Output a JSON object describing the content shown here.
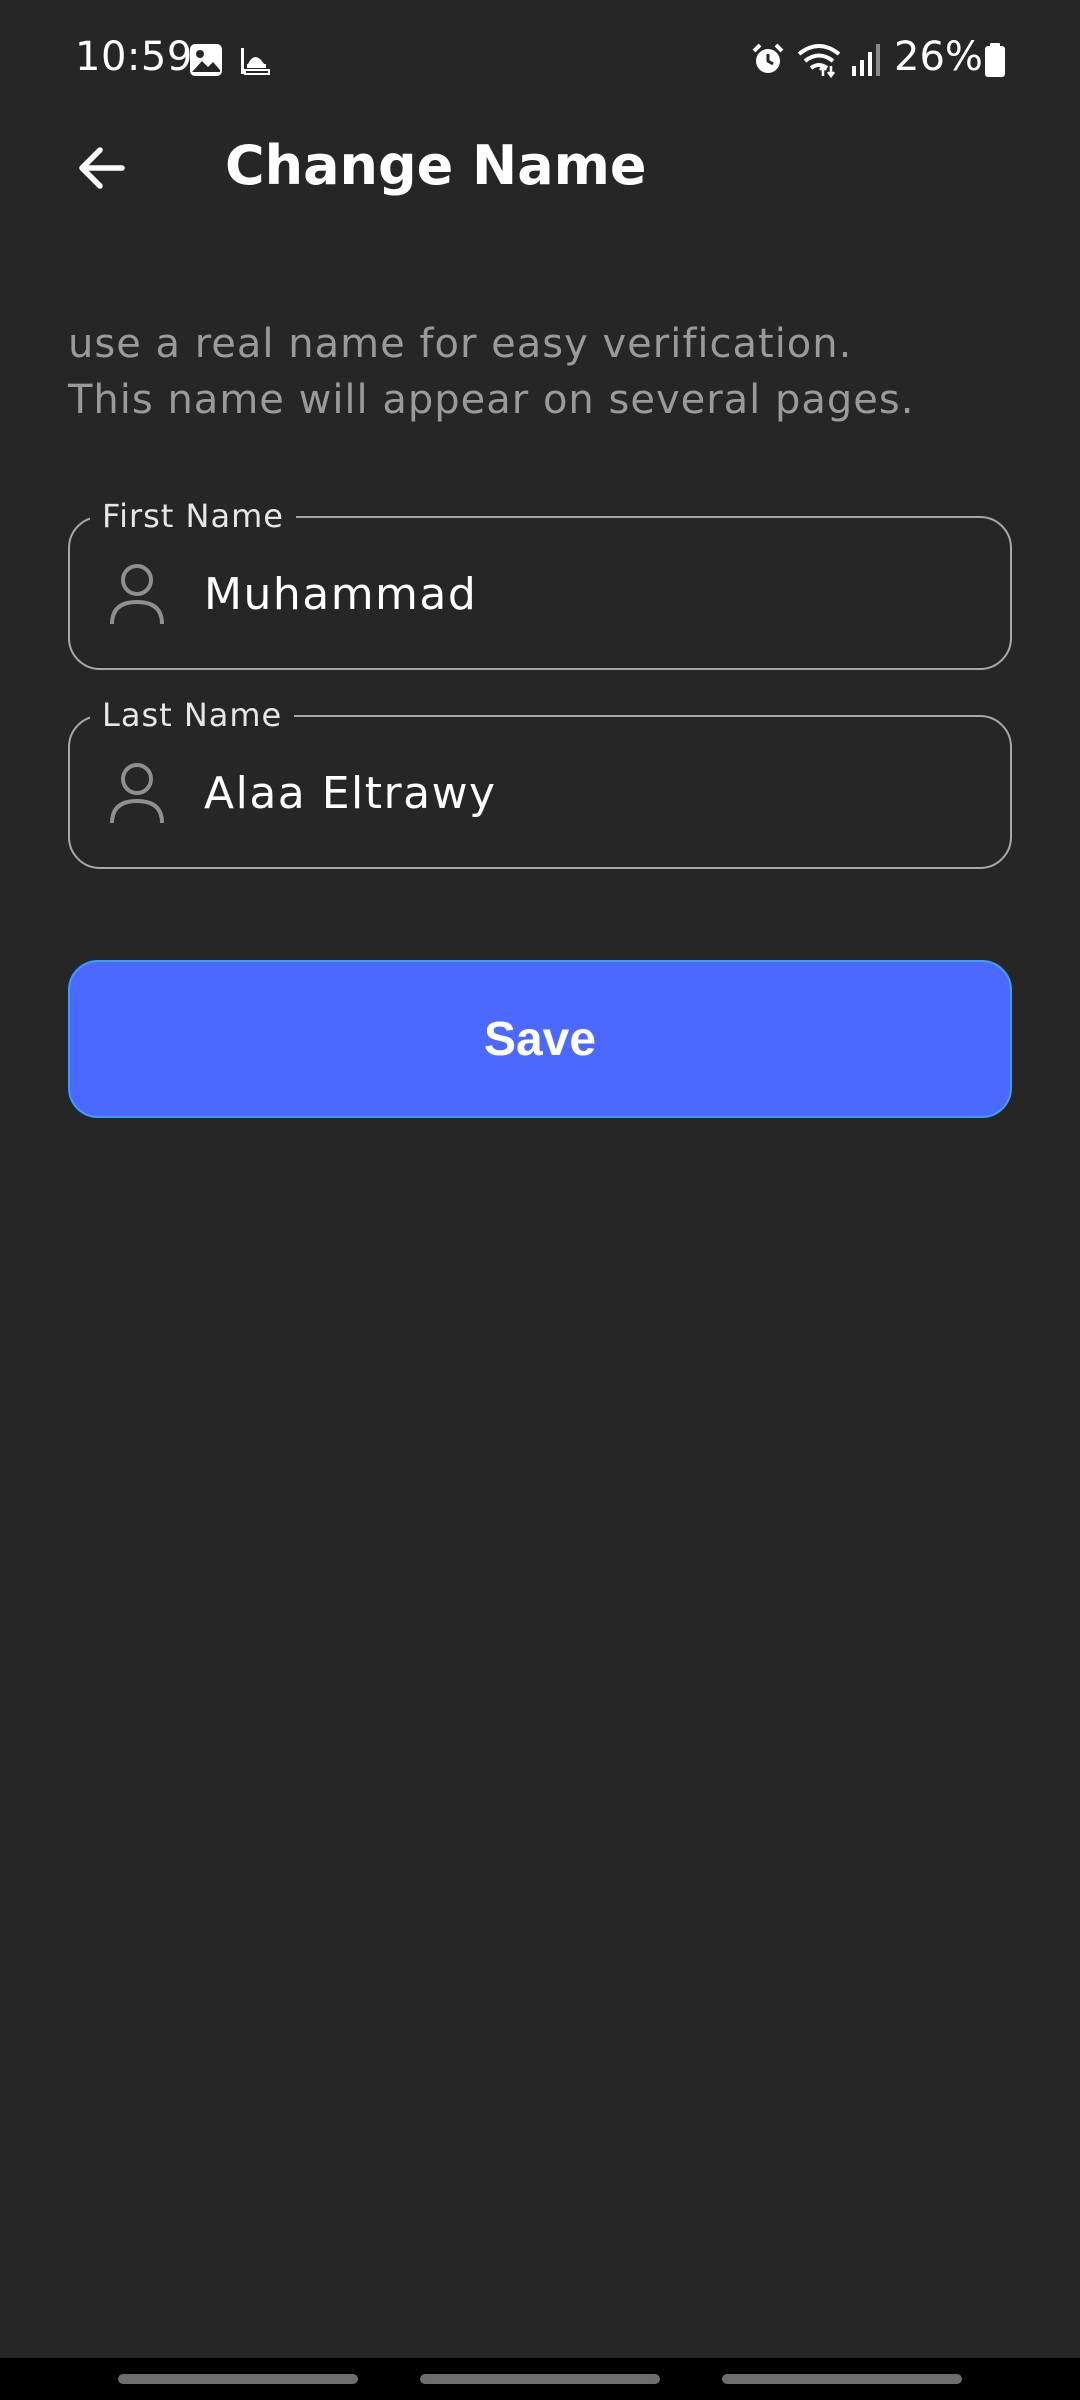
{
  "status_bar": {
    "time": "10:59",
    "battery": "26%",
    "icons": [
      "gallery-icon",
      "mosque-icon",
      "alarm-icon",
      "wifi-icon",
      "signal-icon",
      "battery-icon"
    ]
  },
  "header": {
    "title": "Change Name",
    "back_icon": "arrow-left-icon"
  },
  "description": {
    "line1": "use a real name for easy verification.",
    "line2": "This name will appear on several pages."
  },
  "form": {
    "first_name": {
      "label": "First Name",
      "value": "Muhammad",
      "icon": "person-icon"
    },
    "last_name": {
      "label": "Last Name",
      "value": "Alaa Eltrawy",
      "icon": "person-icon"
    }
  },
  "actions": {
    "save_label": "Save"
  },
  "colors": {
    "background": "#262626",
    "accent": "#4b69ff",
    "muted_text": "#9a9a9a",
    "field_border": "#a8a8a8"
  }
}
